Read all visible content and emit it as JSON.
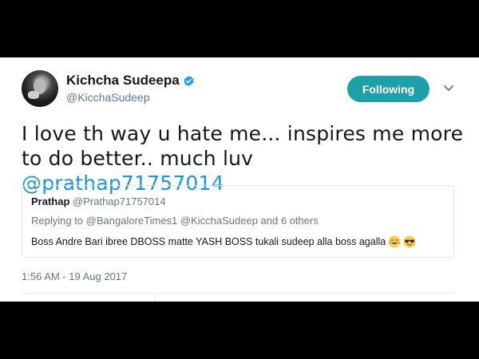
{
  "user": {
    "display_name": "Kichcha Sudeepa",
    "handle": "@KicchaSudeep",
    "verified": true,
    "avatar_icon": "profile-photo"
  },
  "follow_button": {
    "label": "Following",
    "color": "#1da1a8"
  },
  "menu_icon": "chevron-down-icon",
  "tweet": {
    "text": "I love th way u hate me... inspires me more to do better.. much luv",
    "mention": "@prathap71757014",
    "timestamp": "1:56 AM - 19 Aug 2017"
  },
  "quoted_tweet": {
    "name": "Prathap",
    "handle": "@Prathap71757014",
    "replying_prefix": "Replying to",
    "replying_to": "@BangaloreTimes1 @KicchaSudeep",
    "replying_suffix": "and 6 others",
    "body": "Boss Andre Bari ibree DBOSS matte YASH BOSS tukali sudeep alla boss agalla",
    "emojis": [
      "face-with-tears-of-joy",
      "smiling-face-with-sunglasses"
    ]
  },
  "colors": {
    "accent": "#1da1a8",
    "link": "#1b95e0",
    "muted": "#657786",
    "text": "#14171a"
  }
}
